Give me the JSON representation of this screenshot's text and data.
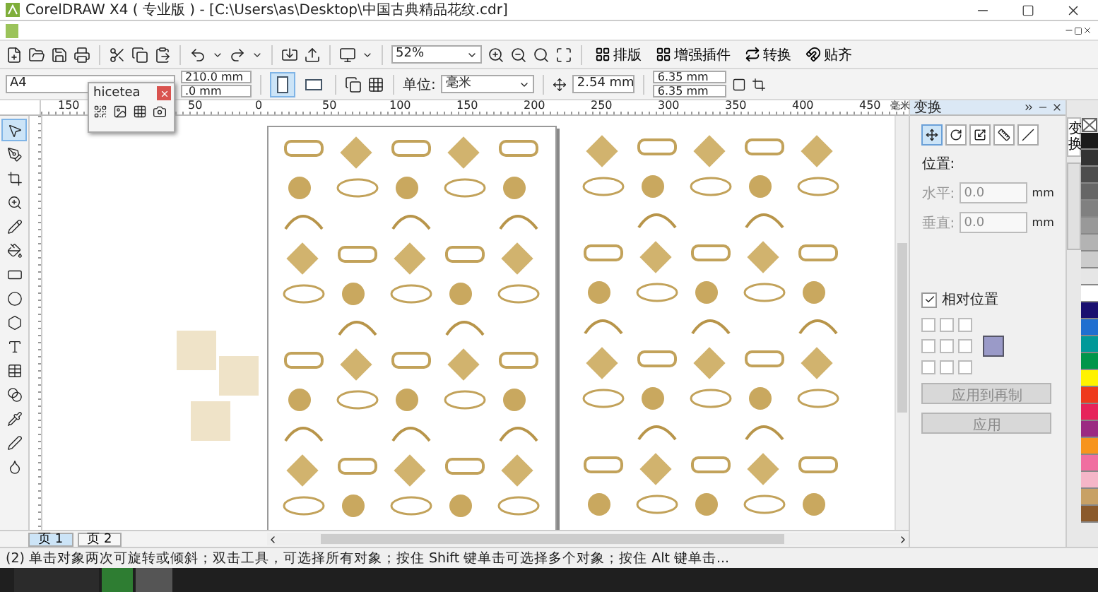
{
  "window": {
    "title": "CorelDRAW X4 ( 专业版 ) - [C:\\Users\\as\\Desktop\\中国古典精品花纹.cdr]"
  },
  "toolbar": {
    "zoom": "52%",
    "buttons": [
      {
        "label": "排版"
      },
      {
        "label": "增强插件"
      },
      {
        "label": "转换"
      },
      {
        "label": "贴齐"
      }
    ]
  },
  "property_bar": {
    "page_size": "A4",
    "width": "210.0 mm",
    "height": ".0 mm",
    "orientation": [
      {
        "kind": "portrait",
        "selected": true
      },
      {
        "kind": "landscape",
        "selected": false
      }
    ],
    "unit_label": "单位:",
    "unit": "毫米",
    "nudge": "2.54 mm",
    "duplicate_x": "6.35 mm",
    "duplicate_y": "6.35 mm"
  },
  "popup": {
    "title": "hicetea"
  },
  "ruler": {
    "left_labels": [
      "150"
    ],
    "labels": [
      "50",
      "0",
      "50",
      "100",
      "150",
      "200",
      "250",
      "300",
      "350",
      "400",
      "450"
    ],
    "unit": "毫米"
  },
  "tools": [
    {
      "kind": "pick",
      "selected": true
    },
    {
      "kind": "shape",
      "selected": false
    },
    {
      "kind": "crop",
      "selected": false
    },
    {
      "kind": "zoom",
      "selected": false
    },
    {
      "kind": "curve",
      "selected": false
    },
    {
      "kind": "fill",
      "selected": false
    },
    {
      "kind": "rectangle",
      "selected": false
    },
    {
      "kind": "ellipse",
      "selected": false
    },
    {
      "kind": "polygon",
      "selected": false
    },
    {
      "kind": "text",
      "selected": false
    },
    {
      "kind": "table",
      "selected": false
    },
    {
      "kind": "blend",
      "selected": false
    },
    {
      "kind": "eyedropper",
      "selected": false
    },
    {
      "kind": "outline",
      "selected": false
    },
    {
      "kind": "bucket",
      "selected": false
    }
  ],
  "docker": {
    "title": "变换",
    "modes": [
      {
        "kind": "position",
        "selected": true
      },
      {
        "kind": "rotate",
        "selected": false
      },
      {
        "kind": "scale",
        "selected": false
      },
      {
        "kind": "size",
        "selected": false
      },
      {
        "kind": "skew",
        "selected": false
      }
    ],
    "section": "位置:",
    "fields": [
      {
        "label": "水平:",
        "value": "0.0",
        "unit": "mm"
      },
      {
        "label": "垂直:",
        "value": "0.0",
        "unit": "mm"
      }
    ],
    "relative": {
      "label": "相对位置",
      "checked": true
    },
    "anchors": [
      {
        "checked": false
      },
      {
        "checked": false
      },
      {
        "checked": false
      },
      {
        "checked": false
      },
      {
        "checked": false
      },
      {
        "checked": false
      },
      {
        "checked": false
      },
      {
        "checked": false
      },
      {
        "checked": false
      }
    ],
    "buttons": [
      {
        "label": "应用到再制",
        "disabled": true
      },
      {
        "label": "应用",
        "disabled": true
      }
    ]
  },
  "side_tabs": [
    {
      "label": "变换",
      "selected": true
    }
  ],
  "palette": [
    {
      "color": "#1a1a1a"
    },
    {
      "color": "#333333"
    },
    {
      "color": "#4d4d4d"
    },
    {
      "color": "#666666"
    },
    {
      "color": "#808080"
    },
    {
      "color": "#999999"
    },
    {
      "color": "#b3b3b3"
    },
    {
      "color": "#cccccc"
    },
    {
      "color": "#e6e6e6"
    },
    {
      "color": "#ffffff"
    },
    {
      "color": "#1a1070"
    },
    {
      "color": "#1f6fd0"
    },
    {
      "color": "#009999"
    },
    {
      "color": "#00964b"
    },
    {
      "color": "#fff200"
    },
    {
      "color": "#ee3a1c"
    },
    {
      "color": "#e6235a"
    },
    {
      "color": "#9b2a82"
    },
    {
      "color": "#f7941d"
    },
    {
      "color": "#f06ea0"
    },
    {
      "color": "#f5b6c8"
    },
    {
      "color": "#c8a165"
    },
    {
      "color": "#8b5a2b"
    }
  ],
  "pages": [
    {
      "label": "页 1",
      "selected": true
    },
    {
      "label": "页 2",
      "selected": false
    }
  ],
  "status_bar": {
    "text": "(2) 单击对象两次可旋转或倾斜；双击工具，可选择所有对象；按住 Shift 键单击可选择多个对象；按住 Alt 键单击..."
  }
}
